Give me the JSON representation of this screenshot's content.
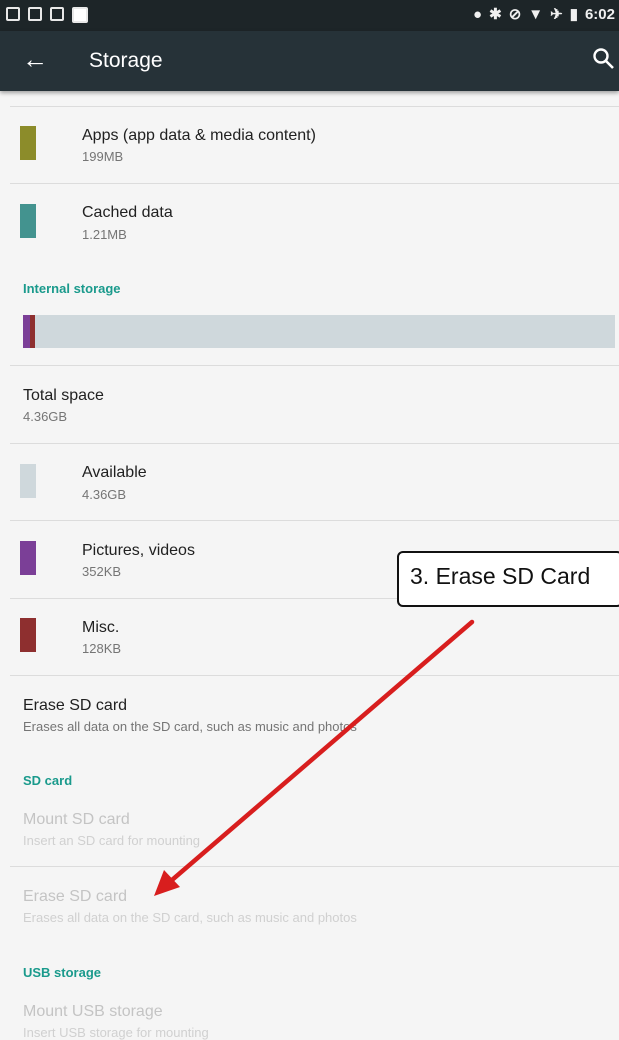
{
  "status_bar": {
    "time": "6:02"
  },
  "app_bar": {
    "title": "Storage"
  },
  "items_top": [
    {
      "label": "Apps (app data & media content)",
      "value": "199MB",
      "color": "#8c8c2a"
    },
    {
      "label": "Cached data",
      "value": "1.21MB",
      "color": "#43938f"
    }
  ],
  "internal": {
    "header": "Internal storage",
    "bar_colors": {
      "track": "#cfd8dc",
      "pictures": "#7b3f97",
      "misc": "#8e2f2f"
    },
    "total_label": "Total space",
    "total_value": "4.36GB",
    "items": [
      {
        "label": "Available",
        "value": "4.36GB",
        "color": "#cfd8dc"
      },
      {
        "label": "Pictures, videos",
        "value": "352KB",
        "color": "#7b3f97"
      },
      {
        "label": "Misc.",
        "value": "128KB",
        "color": "#8e2f2f"
      }
    ],
    "erase_label": "Erase SD card",
    "erase_desc": "Erases all data on the SD card, such as music and photos"
  },
  "sd_card": {
    "header": "SD card",
    "mount_label": "Mount SD card",
    "mount_desc": "Insert an SD card for mounting",
    "erase_label": "Erase SD card",
    "erase_desc": "Erases all data on the SD card, such as music and photos"
  },
  "usb": {
    "header": "USB storage",
    "mount_label": "Mount USB storage",
    "mount_desc": "Insert USB storage for mounting"
  },
  "annotation": {
    "text": "3. Erase SD Card",
    "arrow_color": "#d81e1e"
  }
}
